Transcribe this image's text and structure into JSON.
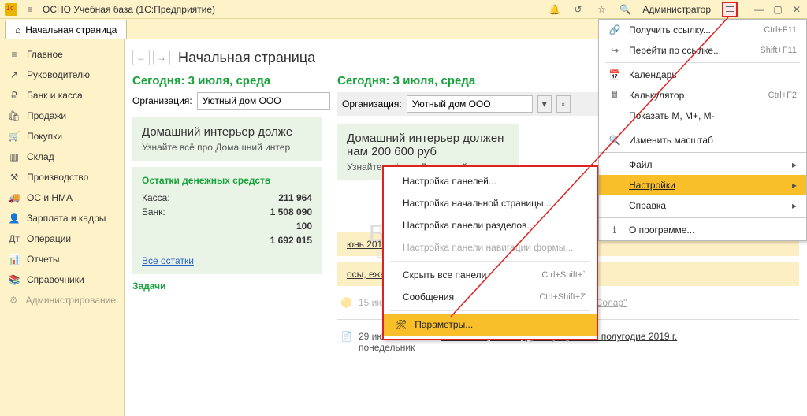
{
  "topbar": {
    "app_title": "ОСНО Учебная база  (1С:Предприятие)",
    "user": "Администратор"
  },
  "tab": {
    "label": "Начальная страница"
  },
  "sidebar": {
    "items": [
      {
        "icon": "≡",
        "label": "Главное"
      },
      {
        "icon": "↗",
        "label": "Руководителю"
      },
      {
        "icon": "₽",
        "label": "Банк и касса"
      },
      {
        "icon": "🛍",
        "label": "Продажи"
      },
      {
        "icon": "🛒",
        "label": "Покупки"
      },
      {
        "icon": "▥",
        "label": "Склад"
      },
      {
        "icon": "⚒",
        "label": "Производство"
      },
      {
        "icon": "🚚",
        "label": "ОС и НМА"
      },
      {
        "icon": "👤",
        "label": "Зарплата и кадры"
      },
      {
        "icon": "Дт",
        "label": "Операции"
      },
      {
        "icon": "📊",
        "label": "Отчеты"
      },
      {
        "icon": "📚",
        "label": "Справочники"
      },
      {
        "icon": "⚙",
        "label": "Администрирование"
      }
    ]
  },
  "page_title": "Начальная страница",
  "left": {
    "date_head": "Сегодня: 3 июля, среда",
    "org_label": "Организация:",
    "org_value": "Уютный дом ООО",
    "panel1": {
      "title": "Домашний интерьер долже",
      "sub": "Узнайте всё про Домашний интер"
    },
    "balances_head": "Остатки денежных средств",
    "rows": [
      {
        "k": "Касса:",
        "v": "211 964"
      },
      {
        "k": "Банк:",
        "v": "1 508 090"
      },
      {
        "k": "",
        "v": "100"
      },
      {
        "k": "",
        "v": "1 692 015"
      }
    ],
    "all_link": "Все остатки",
    "tasks_head": "Задачи"
  },
  "right": {
    "date_head": "Сегодня: 3 июля, среда",
    "org_label": "Организация:",
    "org_value": "Уютный дом ООО",
    "panel1": {
      "title": "Домашний интерьер должен нам 200 600 руб",
      "sub": "Узнайте всё про Домашний инт"
    },
    "task_link1": "юнь 2019 г.",
    "task_link2": "осы, ежемесячная отчетность (СЗВ-М) за июнь",
    "task3_date": "15 июля",
    "task3_text": "Оплата 300 000 руб Бизнес центр \"Солар\"",
    "task4_date": "29 июля, понедельник",
    "task4_text": "Налог на прибыль, декларация за 1 полугодие 2019 г."
  },
  "main_menu": {
    "items": [
      {
        "icon": "🔗",
        "label": "Получить ссылку...",
        "sc": "Ctrl+F11"
      },
      {
        "icon": "↪",
        "label": "Перейти по ссылке...",
        "sc": "Shift+F11"
      },
      {
        "sep": true
      },
      {
        "icon": "📅",
        "label": "Календарь"
      },
      {
        "icon": "🖩",
        "label": "Калькулятор",
        "sc": "Ctrl+F2"
      },
      {
        "icon": "",
        "label": "Показать M, M+, M-"
      },
      {
        "sep": true
      },
      {
        "icon": "🔍",
        "label": "Изменить масштаб"
      },
      {
        "sep": true,
        "full": true
      },
      {
        "icon": "",
        "label": "Файл",
        "arrow": true,
        "u": true
      },
      {
        "icon": "",
        "label": "Настройки",
        "arrow": true,
        "u": true,
        "hl": true
      },
      {
        "icon": "",
        "label": "Справка",
        "arrow": true,
        "u": true
      },
      {
        "sep": true,
        "full": true
      },
      {
        "icon": "ℹ",
        "label": "О программе..."
      }
    ]
  },
  "sub_menu": {
    "items": [
      {
        "label": "Настройка панелей..."
      },
      {
        "label": "Настройка начальной страницы..."
      },
      {
        "label": "Настройка панели разделов..."
      },
      {
        "label": "Настройка панели навигации формы...",
        "dis": true
      },
      {
        "sep": true
      },
      {
        "label": "Скрыть все панели",
        "sc": "Ctrl+Shift+`"
      },
      {
        "label": "Сообщения",
        "sc": "Ctrl+Shift+Z"
      },
      {
        "sep": true
      },
      {
        "icon": "🛠",
        "label": "Параметры...",
        "hl": true
      }
    ]
  }
}
